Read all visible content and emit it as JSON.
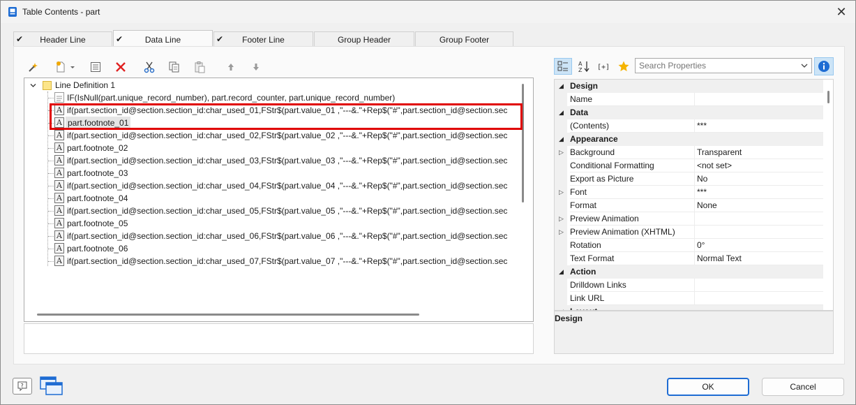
{
  "window": {
    "title": "Table Contents - part"
  },
  "tabs": [
    {
      "label": "Header Line",
      "checked": true,
      "active": false
    },
    {
      "label": "Data Line",
      "checked": true,
      "active": true
    },
    {
      "label": "Footer Line",
      "checked": true,
      "active": false
    },
    {
      "label": "Group Header",
      "checked": false,
      "active": false
    },
    {
      "label": "Group Footer",
      "checked": false,
      "active": false
    }
  ],
  "toolbar": {
    "icons": [
      "wand-icon",
      "new-item-icon",
      "properties-icon",
      "delete-icon",
      "cut-icon",
      "copy-icon",
      "paste-icon",
      "move-up-icon",
      "move-down-icon"
    ]
  },
  "tree": {
    "root": {
      "label": "Line Definition  1"
    },
    "items": [
      {
        "label": "IF(IsNull(part.unique_record_number), part.record_counter, part.unique_record_number)",
        "icon": "page-icon"
      },
      {
        "label": "if(part.section_id@section.section_id:char_used_01,FStr$(part.value_01 ,\"---&.\"+Rep$(\"#\",part.section_id@section.sec",
        "icon": "text-icon"
      },
      {
        "label": "part.footnote_01",
        "icon": "text-icon"
      },
      {
        "label": "if(part.section_id@section.section_id:char_used_02,FStr$(part.value_02 ,\"---&.\"+Rep$(\"#\",part.section_id@section.sec",
        "icon": "text-icon"
      },
      {
        "label": "part.footnote_02",
        "icon": "text-icon"
      },
      {
        "label": "if(part.section_id@section.section_id:char_used_03,FStr$(part.value_03 ,\"---&.\"+Rep$(\"#\",part.section_id@section.sec",
        "icon": "text-icon"
      },
      {
        "label": "part.footnote_03",
        "icon": "text-icon"
      },
      {
        "label": "if(part.section_id@section.section_id:char_used_04,FStr$(part.value_04 ,\"---&.\"+Rep$(\"#\",part.section_id@section.sec",
        "icon": "text-icon"
      },
      {
        "label": "part.footnote_04",
        "icon": "text-icon"
      },
      {
        "label": "if(part.section_id@section.section_id:char_used_05,FStr$(part.value_05 ,\"---&.\"+Rep$(\"#\",part.section_id@section.sec",
        "icon": "text-icon"
      },
      {
        "label": "part.footnote_05",
        "icon": "text-icon"
      },
      {
        "label": "if(part.section_id@section.section_id:char_used_06,FStr$(part.value_06 ,\"---&.\"+Rep$(\"#\",part.section_id@section.sec",
        "icon": "text-icon"
      },
      {
        "label": "part.footnote_06",
        "icon": "text-icon"
      },
      {
        "label": "if(part.section_id@section.section_id:char_used_07,FStr$(part.value_07 ,\"---&.\"+Rep$(\"#\",part.section_id@section.sec",
        "icon": "text-icon"
      }
    ],
    "node_icon_glyph": "A"
  },
  "properties": {
    "search": {
      "placeholder": "Search Properties",
      "value": ""
    },
    "rows": [
      {
        "type": "cat",
        "name": "Design",
        "value": ""
      },
      {
        "type": "prop",
        "name": "Name",
        "value": ""
      },
      {
        "type": "cat",
        "name": "Data",
        "value": ""
      },
      {
        "type": "prop",
        "name": "(Contents)",
        "value": "***"
      },
      {
        "type": "cat",
        "name": "Appearance",
        "value": ""
      },
      {
        "type": "prop",
        "name": "Background",
        "value": "Transparent",
        "expandable": true
      },
      {
        "type": "prop",
        "name": "Conditional Formatting",
        "value": "<not set>"
      },
      {
        "type": "prop",
        "name": "Export as Picture",
        "value": "No"
      },
      {
        "type": "prop",
        "name": "Font",
        "value": "***",
        "expandable": true
      },
      {
        "type": "prop",
        "name": "Format",
        "value": "None"
      },
      {
        "type": "prop",
        "name": "Preview Animation",
        "value": "",
        "expandable": true
      },
      {
        "type": "prop",
        "name": "Preview Animation (XHTML)",
        "value": "",
        "expandable": true
      },
      {
        "type": "prop",
        "name": "Rotation",
        "value": "0°"
      },
      {
        "type": "prop",
        "name": "Text Format",
        "value": "Normal Text"
      },
      {
        "type": "cat",
        "name": "Action",
        "value": ""
      },
      {
        "type": "prop",
        "name": "Drilldown Links",
        "value": ""
      },
      {
        "type": "prop",
        "name": "Link URL",
        "value": ""
      },
      {
        "type": "cat",
        "name": "Layout",
        "value": ""
      }
    ],
    "description_title": "Design"
  },
  "buttons": {
    "ok": "OK",
    "cancel": "Cancel"
  },
  "colors": {
    "accent": "#1e6cd3",
    "highlight": "#e00000",
    "delete": "#e02020"
  }
}
